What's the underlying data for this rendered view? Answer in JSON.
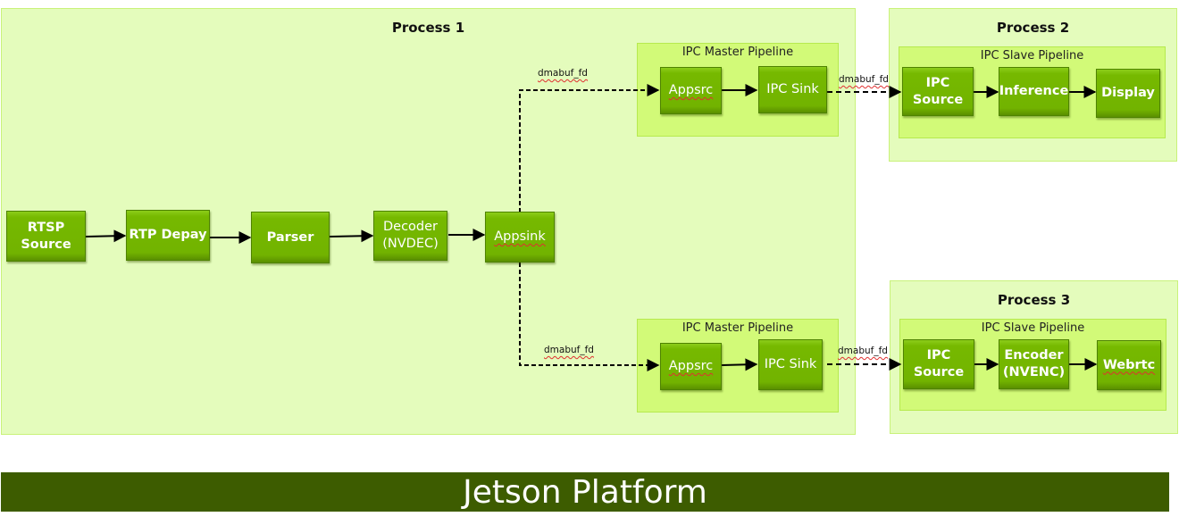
{
  "colors": {
    "process_bg": "#e4fcbc",
    "pipeline_bg": "#d2fa78",
    "node_green": "#76b900",
    "platform_bg": "#3d5c00"
  },
  "processes": [
    {
      "id": "p1",
      "title": "Process 1"
    },
    {
      "id": "p2",
      "title": "Process 2"
    },
    {
      "id": "p3",
      "title": "Process 3"
    }
  ],
  "pipelines": {
    "master_top": "IPC Master Pipeline",
    "master_bottom": "IPC Master Pipeline",
    "slave_top": "IPC Slave Pipeline",
    "slave_bottom": "IPC Slave Pipeline"
  },
  "nodes": {
    "rtsp_source": "RTSP\nSource",
    "rtp_depay": "RTP Depay",
    "parser": "Parser",
    "decoder": "Decoder\n(NVDEC)",
    "appsink": "Appsink",
    "appsrc_top": "Appsrc",
    "ipc_sink_top": "IPC Sink",
    "appsrc_bottom": "Appsrc",
    "ipc_sink_bottom": "IPC Sink",
    "ipc_source_top": "IPC\nSource",
    "inference": "Inference",
    "display": "Display",
    "ipc_source_bottom": "IPC\nSource",
    "encoder": "Encoder\n(NVENC)",
    "webrtc": "Webrtc"
  },
  "edge_labels": {
    "appsink_to_appsrc_top": "dmabuf_fd",
    "appsink_to_appsrc_bottom": "dmabuf_fd",
    "ipcsink_to_ipcsource_top": "dmabuf_fd",
    "ipcsink_to_ipcsource_bottom": "dmabuf_fd"
  },
  "platform": {
    "label": "Jetson Platform"
  }
}
